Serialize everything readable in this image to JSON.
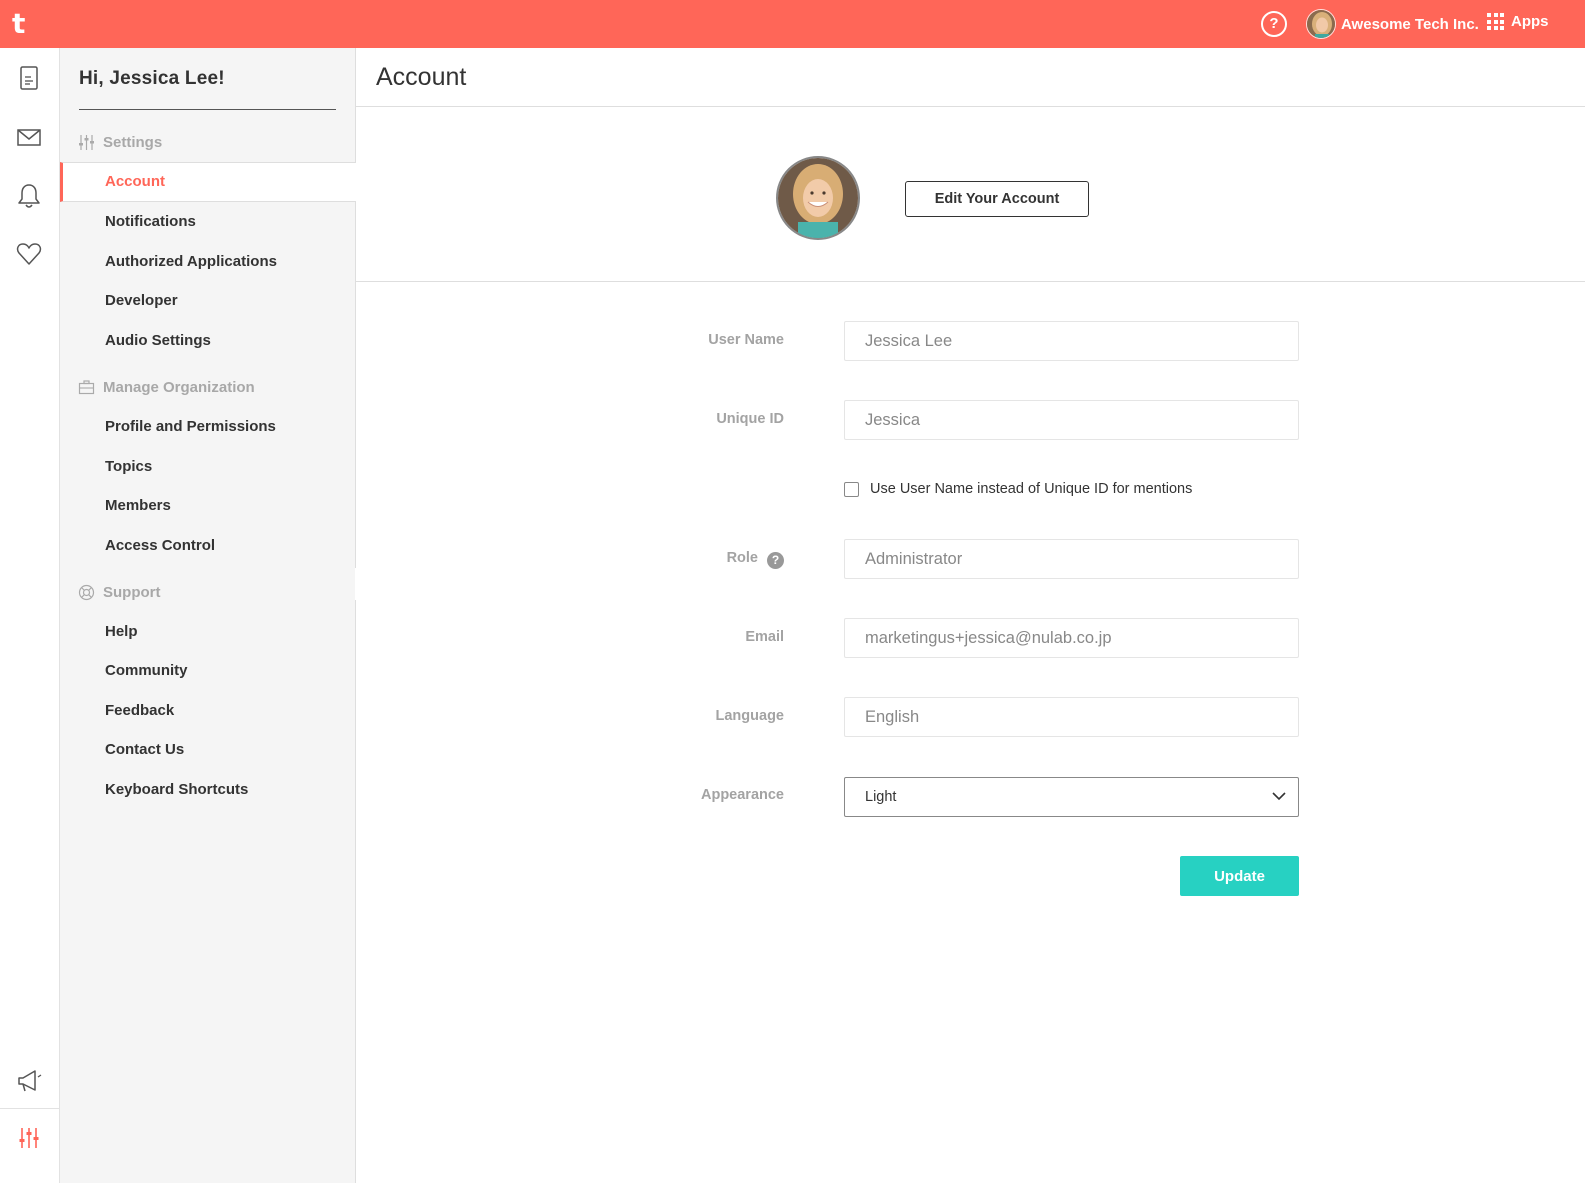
{
  "topbar": {
    "help_glyph": "?",
    "org_name": "Awesome Tech Inc.",
    "apps_label": "Apps",
    "brand_color": "#ff6658"
  },
  "rail": {
    "icons": [
      "document-icon",
      "mail-icon",
      "bell-icon",
      "heart-icon",
      "megaphone-icon",
      "sliders-icon"
    ]
  },
  "sidebar": {
    "greeting": "Hi, Jessica Lee!",
    "settings": {
      "title": "Settings",
      "items": [
        "Account",
        "Notifications",
        "Authorized Applications",
        "Developer",
        "Audio Settings"
      ]
    },
    "manage": {
      "title": "Manage Organization",
      "items": [
        "Profile and Permissions",
        "Topics",
        "Members",
        "Access Control"
      ]
    },
    "support": {
      "title": "Support",
      "items": [
        "Help",
        "Community",
        "Feedback",
        "Contact Us",
        "Keyboard Shortcuts"
      ]
    }
  },
  "main": {
    "title": "Account",
    "edit_button": "Edit Your Account",
    "form": {
      "user_name_label": "User Name",
      "user_name_value": "Jessica Lee",
      "unique_id_label": "Unique ID",
      "unique_id_value": "Jessica",
      "mention_checkbox_label": "Use User Name instead of Unique ID for mentions",
      "role_label": "Role",
      "role_help": "?",
      "role_value": "Administrator",
      "email_label": "Email",
      "email_value": "marketingus+jessica@nulab.co.jp",
      "language_label": "Language",
      "language_value": "English",
      "appearance_label": "Appearance",
      "appearance_value": "Light",
      "update_button": "Update",
      "update_color": "#27d1c2"
    }
  }
}
